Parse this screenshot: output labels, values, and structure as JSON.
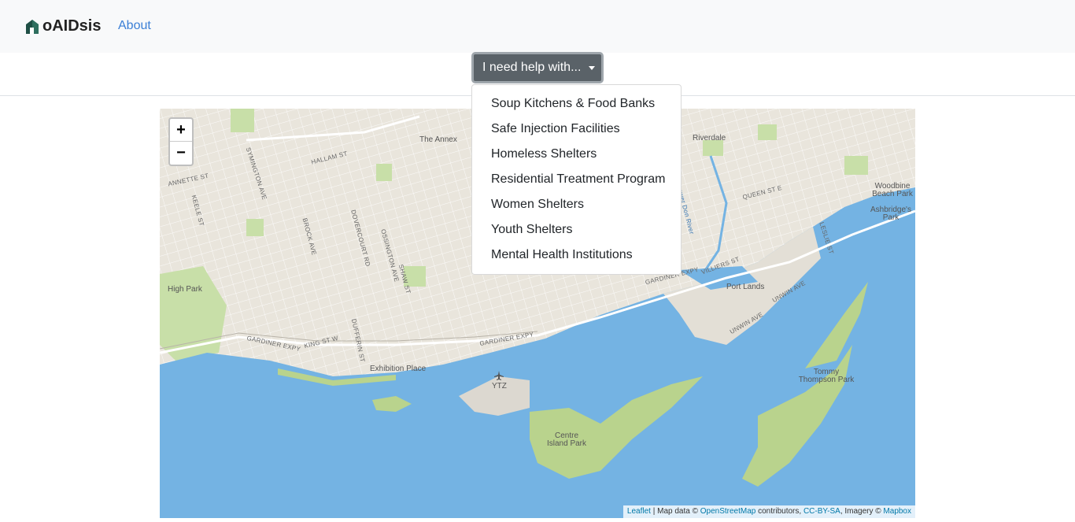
{
  "navbar": {
    "brand": "oAIDsis",
    "about": "About"
  },
  "dropdown": {
    "toggle_label": "I need help with...",
    "items": [
      "Soup Kitchens & Food Banks",
      "Safe Injection Facilities",
      "Homeless Shelters",
      "Residential Treatment Program",
      "Women Shelters",
      "Youth Shelters",
      "Mental Health Institutions"
    ]
  },
  "map": {
    "zoom_in": "+",
    "zoom_out": "−",
    "places": {
      "annex": "The Annex",
      "riverdale": "Riverdale",
      "woodbine": "Woodbine Beach Park",
      "ashbridge": "Ashbridge's Park",
      "high_park": "High Park",
      "port_lands": "Port Lands",
      "exhibition": "Exhibition Place",
      "ytz": "YTZ",
      "centre_island": "Centre Island Park",
      "tommy_thompson": "Tommy Thompson Park"
    },
    "streets": {
      "annette": "ANNETTE ST",
      "hallam": "HALLAM ST",
      "symington": "SYMINGTON AVE",
      "keele": "KEELE ST",
      "brock": "BROCK AVE",
      "dovercourt": "DOVERCOURT RD",
      "ossington": "OSSINGTON AVE",
      "shaw": "SHAW ST",
      "queen_e": "QUEEN ST E",
      "leslie": "LESLIE ST",
      "gardiner1": "GARDINER EXPY",
      "gardiner2": "GARDINER EXPY",
      "gardiner3": "GARDINER EXPY",
      "king": "KING ST W",
      "dufferin": "DUFFERIN ST",
      "villiers": "VILLIERS ST",
      "unwin1": "UNWIN AVE",
      "unwin2": "UNWIN AVE",
      "don_river": "Lower Don River"
    },
    "attribution": {
      "leaflet": "Leaflet",
      "text1": " | Map data © ",
      "osm": "OpenStreetMap",
      "text2": " contributors, ",
      "license": "CC-BY-SA",
      "text3": ", Imagery © ",
      "mapbox": "Mapbox"
    }
  },
  "colors": {
    "water": "#74b3e3",
    "land": "#e9e5dc",
    "park": "#c8dfa8",
    "button": "#5a6268",
    "link": "#3b7fd6"
  }
}
